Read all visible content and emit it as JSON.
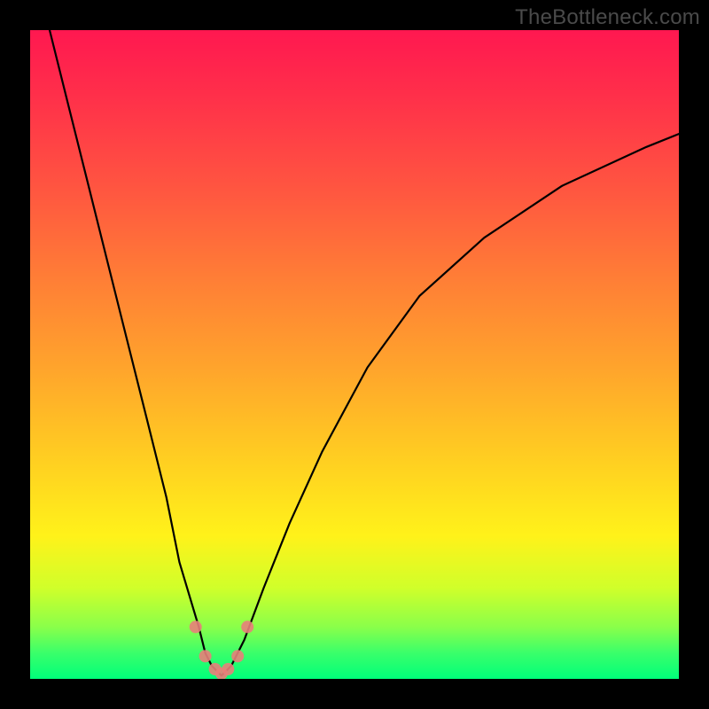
{
  "watermark": "TheBottleneck.com",
  "chart_data": {
    "type": "line",
    "title": "",
    "xlabel": "",
    "ylabel": "",
    "xlim": [
      0,
      100
    ],
    "ylim": [
      0,
      100
    ],
    "grid": false,
    "legend": false,
    "series": [
      {
        "name": "bottleneck-curve",
        "x": [
          3,
          6,
          9,
          12,
          15,
          18,
          21,
          23,
          26,
          27,
          28,
          29.5,
          31,
          33,
          36,
          40,
          45,
          52,
          60,
          70,
          82,
          95,
          100
        ],
        "y": [
          100,
          88,
          76,
          64,
          52,
          40,
          28,
          18,
          8,
          4,
          2,
          0.5,
          2,
          6,
          14,
          24,
          35,
          48,
          59,
          68,
          76,
          82,
          84
        ]
      }
    ],
    "markers": {
      "name": "red-dots",
      "points": [
        {
          "x": 25.5,
          "y": 8.0
        },
        {
          "x": 27.0,
          "y": 3.5
        },
        {
          "x": 28.5,
          "y": 1.5
        },
        {
          "x": 29.5,
          "y": 0.8
        },
        {
          "x": 30.5,
          "y": 1.5
        },
        {
          "x": 32.0,
          "y": 3.5
        },
        {
          "x": 33.5,
          "y": 8.0
        }
      ]
    },
    "background_gradient": {
      "top": "#ff1850",
      "mid1": "#ff7d36",
      "mid2": "#fff21a",
      "bottom": "#00ff7a"
    }
  }
}
